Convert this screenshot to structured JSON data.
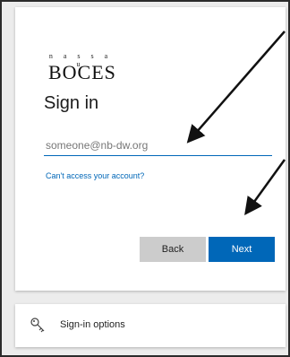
{
  "logo": {
    "top_text": "n a s s a u",
    "main_text": "BOCES"
  },
  "signin": {
    "title": "Sign in",
    "email_placeholder": "someone@nb-dw.org",
    "cant_access_link": "Can't access your account?",
    "back_label": "Back",
    "next_label": "Next"
  },
  "options": {
    "label": "Sign-in options",
    "icon": "key-icon"
  },
  "colors": {
    "accent": "#0067b8",
    "back_button": "#cccccc",
    "page_bg": "#ececec"
  }
}
